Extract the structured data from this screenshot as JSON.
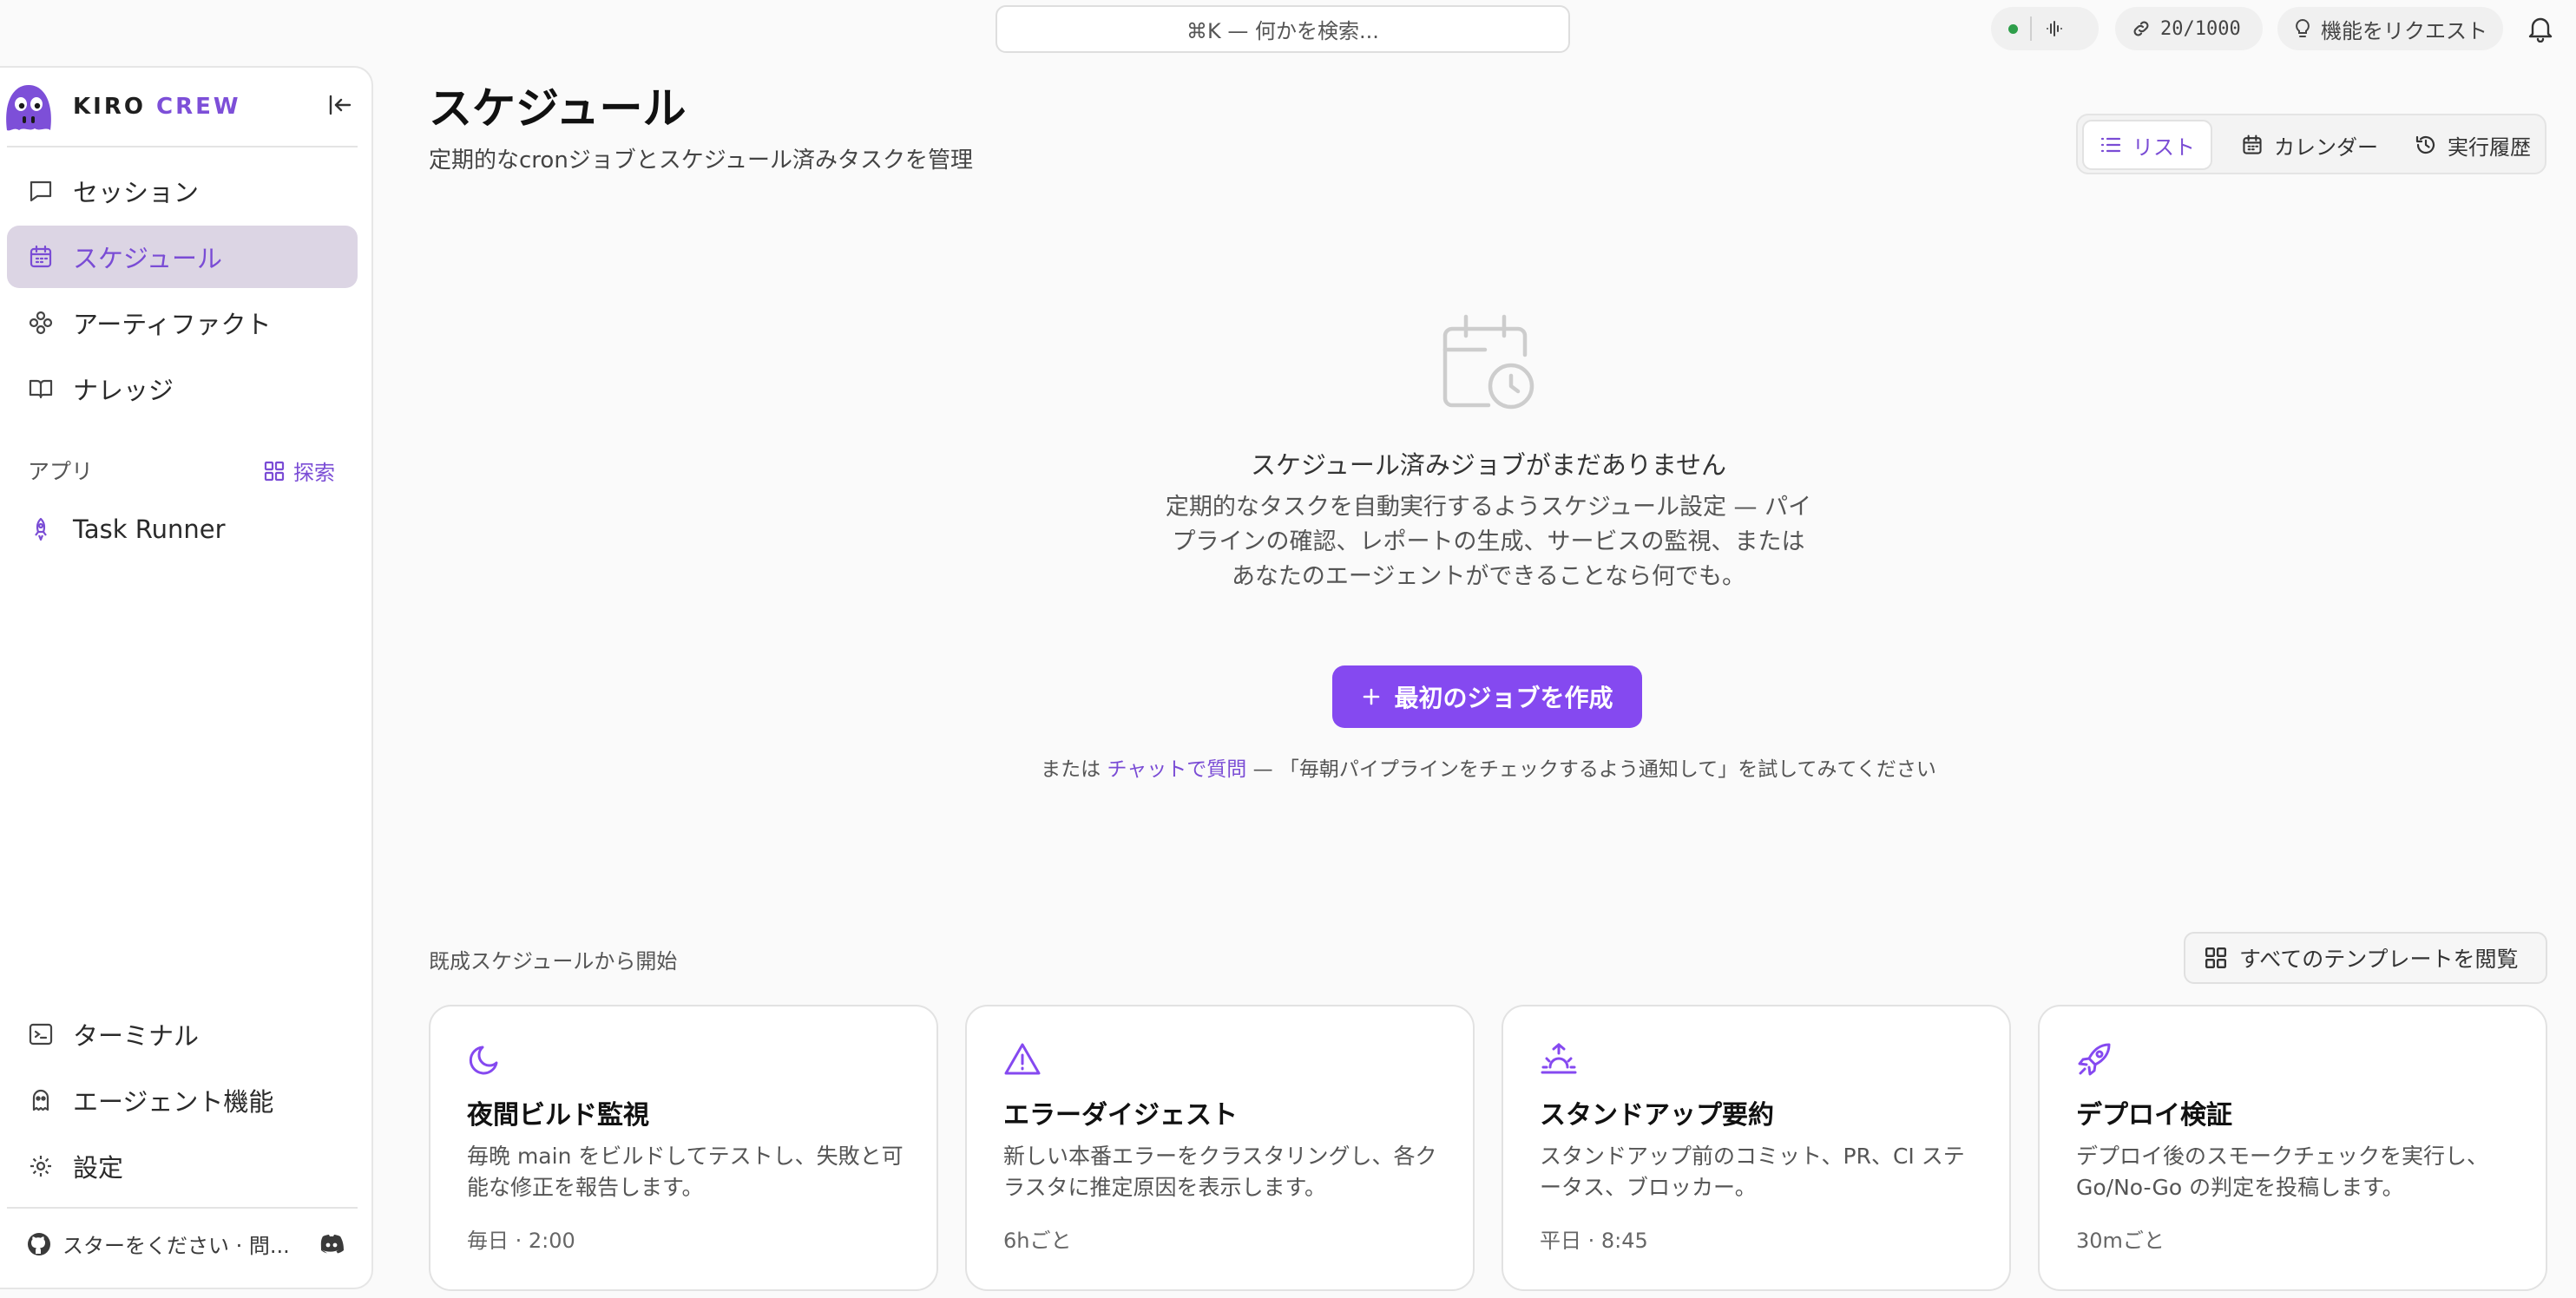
{
  "search": {
    "placeholder": "⌘K — 何かを検索..."
  },
  "topbar": {
    "usage": "20/1000",
    "request_feature": "機能をリクエスト"
  },
  "brand": {
    "name_a": "KIRO",
    "name_b": "CREW"
  },
  "sidebar": {
    "items": [
      {
        "label": "セッション",
        "icon": "chat-icon"
      },
      {
        "label": "スケジュール",
        "icon": "calendar-icon",
        "active": true
      },
      {
        "label": "アーティファクト",
        "icon": "artifact-icon"
      },
      {
        "label": "ナレッジ",
        "icon": "book-icon"
      }
    ],
    "apps_label": "アプリ",
    "explore_label": "探索",
    "apps": [
      {
        "label": "Task Runner",
        "icon": "rocket-icon"
      }
    ],
    "bottom_items": [
      {
        "label": "ターミナル",
        "icon": "terminal-icon"
      },
      {
        "label": "エージェント機能",
        "icon": "agent-icon"
      },
      {
        "label": "設定",
        "icon": "gear-icon"
      }
    ],
    "footer_text": "スターをください · 問..."
  },
  "header": {
    "title": "スケジュール",
    "subtitle": "定期的なcronジョブとスケジュール済みタスクを管理",
    "views": {
      "list": "リスト",
      "calendar": "カレンダー",
      "history": "実行履歴"
    }
  },
  "empty_state": {
    "title": "スケジュール済みジョブがまだありません",
    "description": "定期的なタスクを自動実行するようスケジュール設定 — パイプラインの確認、レポートの生成、サービスの監視、またはあなたのエージェントができることなら何でも。",
    "create_button": "最初のジョブを作成",
    "hint_prefix": "または",
    "hint_link": "チャットで質問",
    "hint_suffix": "— 「毎朝パイプラインをチェックするよう通知して」を試してみてください"
  },
  "templates": {
    "label": "既成スケジュールから開始",
    "browse_button": "すべてのテンプレートを閲覧",
    "cards": [
      {
        "title": "夜間ビルド監視",
        "description": "毎晩 main をビルドしてテストし、失敗と可能な修正を報告します。",
        "schedule": "毎日 · 2:00",
        "icon": "moon-icon"
      },
      {
        "title": "エラーダイジェスト",
        "description": "新しい本番エラーをクラスタリングし、各クラスタに推定原因を表示します。",
        "schedule": "6hごと",
        "icon": "warning-icon"
      },
      {
        "title": "スタンドアップ要約",
        "description": "スタンドアップ前のコミット、PR、CI ステータス、ブロッカー。",
        "schedule": "平日 · 8:45",
        "icon": "sunrise-icon"
      },
      {
        "title": "デプロイ検証",
        "description": "デプロイ後のスモークチェックを実行し、Go/No-Go の判定を投稿します。",
        "schedule": "30mごと",
        "icon": "rocket-icon"
      }
    ]
  },
  "colors": {
    "accent": "#8549f0",
    "accent_text": "#7a4cd5",
    "active_bg": "#dcd5e4",
    "status_ok": "#2e9e4a"
  }
}
